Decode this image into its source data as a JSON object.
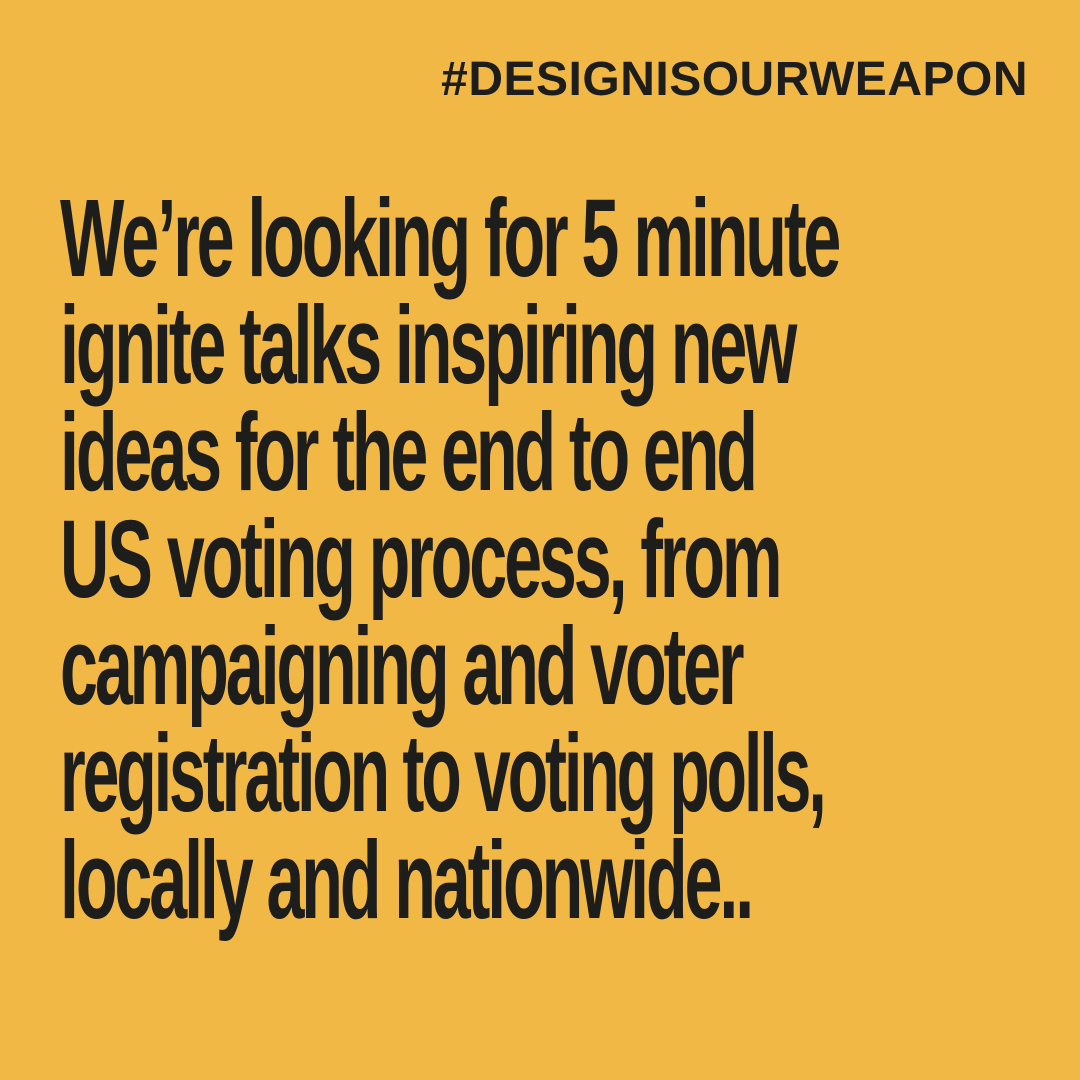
{
  "poster": {
    "background_color": "#f1b845",
    "text_color": "#1d1d1b",
    "hashtag": "#DESIGNISOURWEAPON",
    "lines": [
      {
        "emphasis": "We",
        "text": "’re looking for "
      },
      {
        "emphasis": "5",
        "text": " minute"
      },
      {
        "text": "ignite talks inspiring new"
      },
      {
        "text": "ideas for the end to end"
      },
      {
        "emphasis": "US",
        "text": " voting process, from"
      },
      {
        "text": "campaigning and voter"
      },
      {
        "text": "registration to voting polls,"
      },
      {
        "text": "locally and nationwide.."
      }
    ]
  }
}
